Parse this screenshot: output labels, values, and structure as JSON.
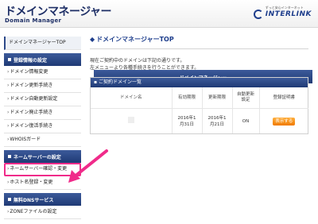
{
  "header": {
    "title": "ドメインマネージャー",
    "subtitle": "Domain Manager",
    "brand_tag": "ずっと安心インターネット",
    "brand_name": "INTERLINK"
  },
  "sidebar": {
    "title": "ドメインマネージャー",
    "top_item": "ドメインマネージャーTOP",
    "sections": [
      {
        "title": "登録情報の設定",
        "items": [
          "ドメイン情報変更",
          "ドメイン更新手続き",
          "ドメイン自動更新設定",
          "ドメイン廃止手続き",
          "ドメイン復活手続き",
          "WHOISガード"
        ]
      },
      {
        "title": "ネームサーバーの設定",
        "items": [
          "ネームサーバー確認・変更",
          "ホスト名登録・変更"
        ]
      },
      {
        "title": "無料DNSサービス",
        "items": [
          "ZONEファイルの設定"
        ]
      }
    ]
  },
  "main": {
    "title": "ドメインマネージャーTOP",
    "intro_line1": "現在ご契約中のドメインは下記の通りです。",
    "intro_line2": "左メニューより各種手続きを行うことができます。",
    "panel_title": "ご契約ドメイン一覧",
    "columns": [
      "ドメイン名",
      "有効期限",
      "更新期限",
      "自動更新\n設定",
      "登録証明書"
    ],
    "row": {
      "expiry": "2016年1\n月31日",
      "renewal": "2016年1\n月21日",
      "auto": "ON",
      "button": "表示する"
    }
  },
  "colors": {
    "nav": "#1f3a75",
    "accent": "#f07a00",
    "highlight": "#f02b8a"
  }
}
